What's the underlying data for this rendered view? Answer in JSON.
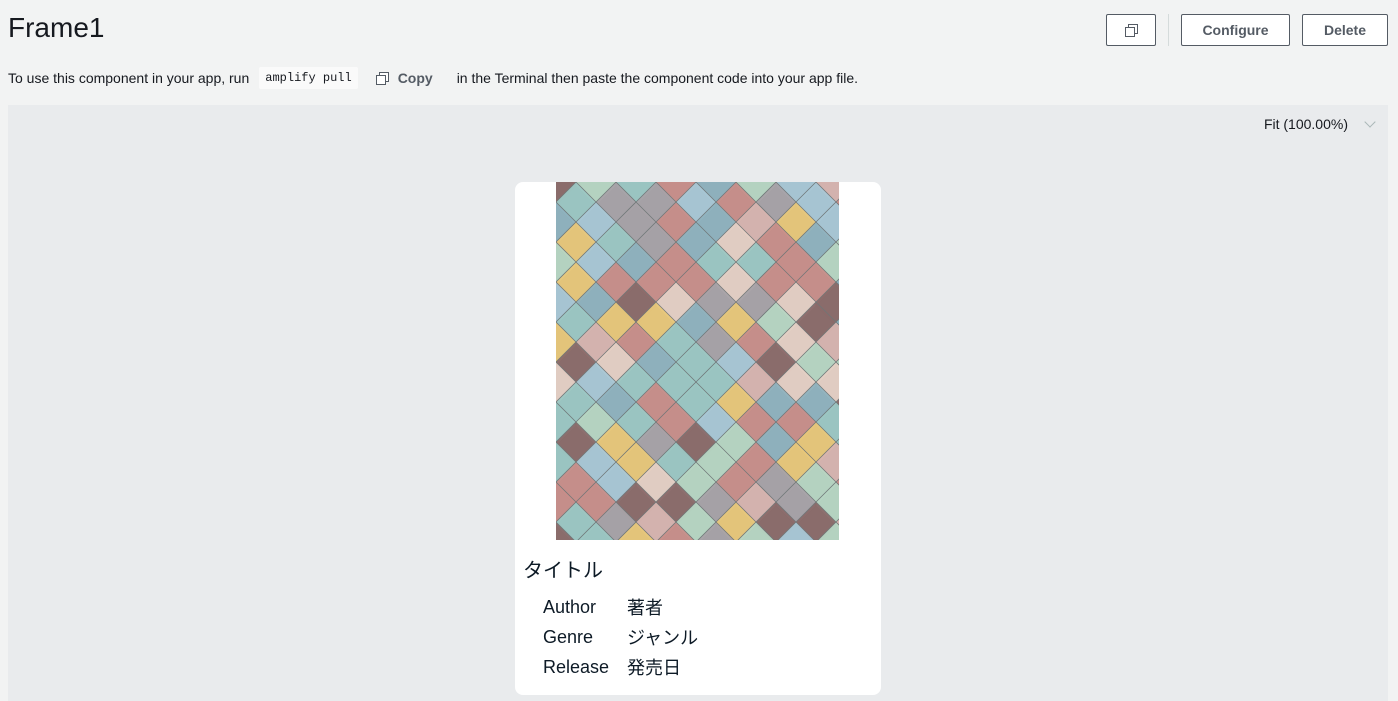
{
  "header": {
    "title": "Frame1",
    "configure_label": "Configure",
    "delete_label": "Delete"
  },
  "hint": {
    "before": "To use this component in your app, run",
    "command": "amplify pull",
    "copy_label": "Copy",
    "after": "in the Terminal then paste the component code into your app file."
  },
  "canvas": {
    "zoom_label": "Fit (100.00%)"
  },
  "card": {
    "title": "タイトル",
    "rows": [
      {
        "label": "Author",
        "value": "著者"
      },
      {
        "label": "Genre",
        "value": "ジャンル"
      },
      {
        "label": "Release",
        "value": "発売日"
      }
    ]
  },
  "colors": {
    "page_bg": "#f2f3f3",
    "canvas_bg": "#e9ebed",
    "button_border": "#545b64",
    "tile_palette": [
      "#9cc8c4",
      "#a9c8d6",
      "#8fb3bf",
      "#e9c87a",
      "#c98f8a",
      "#d8b5b0",
      "#b7d6c3",
      "#8b6b6a",
      "#e6d0c5",
      "#a8a3a8"
    ]
  }
}
